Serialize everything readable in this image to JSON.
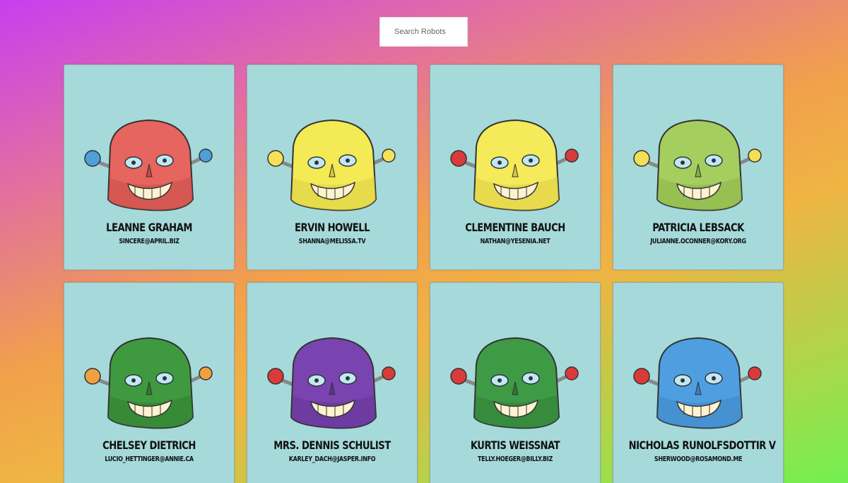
{
  "search": {
    "placeholder": "Search Robots",
    "value": ""
  },
  "robots": [
    {
      "name": "LEANNE GRAHAM",
      "email": "SINCERE@APRIL.BIZ",
      "color": "#e6655e",
      "dark": "#c04a45",
      "antenna": "#4f9fd9"
    },
    {
      "name": "ERVIN HOWELL",
      "email": "SHANNA@MELISSA.TV",
      "color": "#f3ea56",
      "dark": "#d6c93d",
      "antenna": "#f6e058"
    },
    {
      "name": "CLEMENTINE BAUCH",
      "email": "NATHAN@YESENIA.NET",
      "color": "#f4ea5a",
      "dark": "#d8c93d",
      "antenna": "#d93a3a"
    },
    {
      "name": "PATRICIA LEBSACK",
      "email": "JULIANNE.OCONNER@KORY.ORG",
      "color": "#a4cf5e",
      "dark": "#86ad45",
      "antenna": "#f2de58"
    },
    {
      "name": "CHELSEY DIETRICH",
      "email": "LUCIO_HETTINGER@ANNIE.CA",
      "color": "#3f9a3f",
      "dark": "#2f7a2f",
      "antenna": "#f0a040"
    },
    {
      "name": "MRS. DENNIS SCHULIST",
      "email": "KARLEY_DACH@JASPER.INFO",
      "color": "#7a44b0",
      "dark": "#5f3190",
      "antenna": "#d93a3a"
    },
    {
      "name": "KURTIS WEISSNAT",
      "email": "TELLY.HOEGER@BILLY.BIZ",
      "color": "#3f9a45",
      "dark": "#2e7a33",
      "antenna": "#d93a3a"
    },
    {
      "name": "NICHOLAS RUNOLFSDOTTIR V",
      "email": "SHERWOOD@ROSAMOND.ME",
      "color": "#4f9fe0",
      "dark": "#3a80c0",
      "antenna": "#d93a3a"
    }
  ]
}
